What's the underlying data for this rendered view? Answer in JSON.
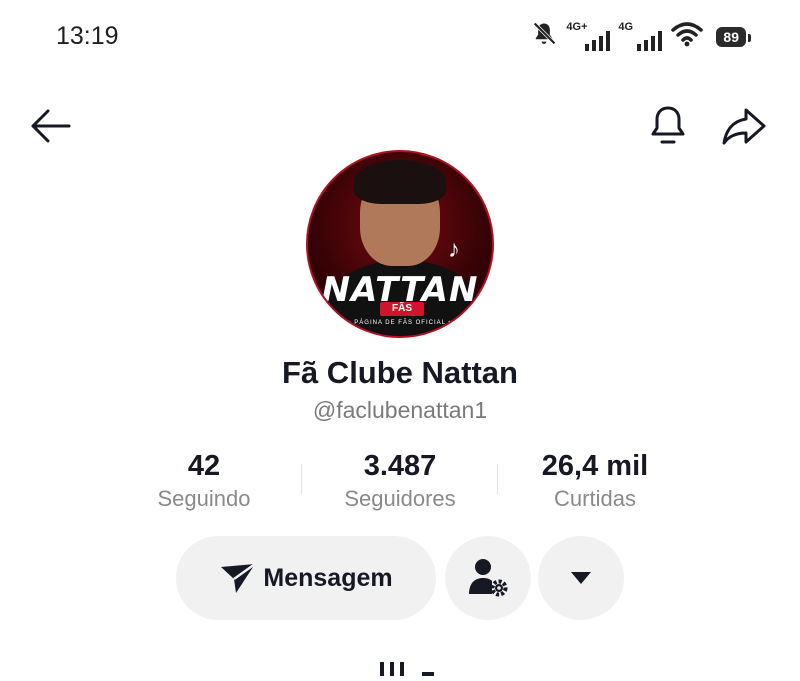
{
  "status_bar": {
    "time": "13:19",
    "signal1_label": "4G+",
    "signal2_label": "4G",
    "battery": "89",
    "icons": [
      "muted-bell-icon",
      "signal-icon",
      "signal-icon",
      "wifi-icon",
      "battery-icon"
    ]
  },
  "nav": {
    "back_icon": "arrow-left-icon",
    "bell_icon": "bell-icon",
    "share_icon": "share-arrow-icon"
  },
  "avatar": {
    "brand_text": "NATTAN",
    "brand_sub": "FÃS",
    "tagline": "• PÁGINA DE FÃS OFICIAL •"
  },
  "profile": {
    "name": "Fã Clube Nattan",
    "handle": "@faclubenattan1"
  },
  "stats": [
    {
      "value": "42",
      "label": "Seguindo"
    },
    {
      "value": "3.487",
      "label": "Seguidores"
    },
    {
      "value": "26,4 mil",
      "label": "Curtidas"
    }
  ],
  "actions": {
    "message_label": "Mensagem",
    "message_icon": "send-icon",
    "user_settings_icon": "user-gear-icon",
    "dropdown_icon": "caret-down-icon"
  },
  "colors": {
    "text": "#161823",
    "secondary_text": "#8a8a8a",
    "button_bg": "#f1f1f2"
  }
}
